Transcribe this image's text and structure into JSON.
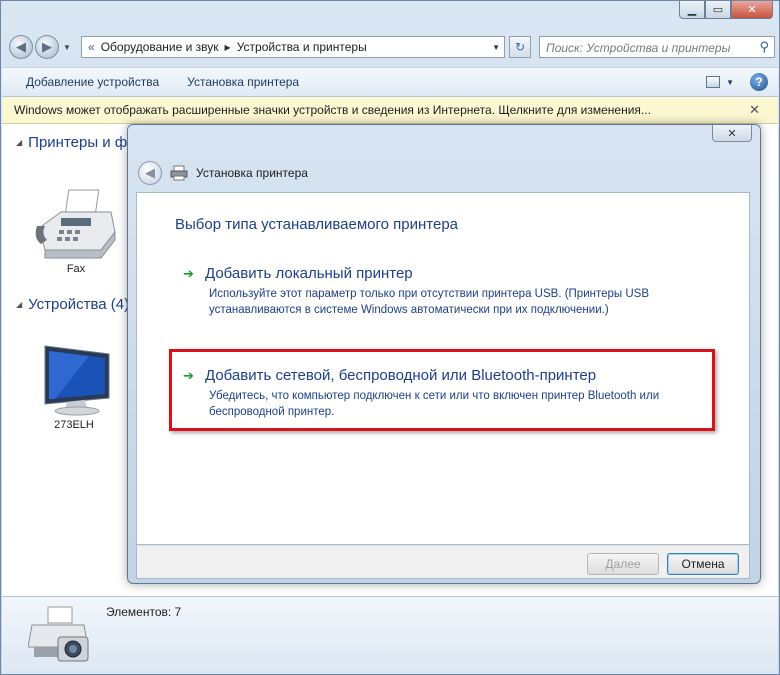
{
  "window": {
    "caption_buttons": {
      "minimize": "▁",
      "maximize": "▭",
      "close": "✕"
    }
  },
  "nav": {
    "back_icon": "◀",
    "forward_icon": "▶",
    "breadcrumb": [
      "Оборудование и звук",
      "Устройства и принтеры"
    ],
    "search_placeholder": "Поиск: Устройства и принтеры"
  },
  "toolbar": {
    "add_device": "Добавление устройства",
    "add_printer": "Установка принтера"
  },
  "infobar": {
    "text": "Windows может отображать расширенные значки устройств и сведения из Интернета.  Щелкните для изменения..."
  },
  "groups": {
    "printers": "Принтеры и ф",
    "devices": "Устройства (4)"
  },
  "devices": {
    "fax": "Fax",
    "monitor": "273ELH"
  },
  "status": {
    "items": "Элементов: 7"
  },
  "dialog": {
    "title": "Установка принтера",
    "heading": "Выбор типа устанавливаемого принтера",
    "options": [
      {
        "title": "Добавить локальный принтер",
        "desc": "Используйте этот параметр только при отсутствии принтера USB. (Принтеры USB устанавливаются в системе Windows автоматически при их подключении.)"
      },
      {
        "title": "Добавить сетевой, беспроводной или Bluetooth-принтер",
        "desc": "Убедитесь, что компьютер подключен к сети или что включен принтер Bluetooth или беспроводной принтер."
      }
    ],
    "next": "Далее",
    "cancel": "Отмена"
  },
  "colors": {
    "accent_blue": "#1d3f8a",
    "highlight_red": "#d6131a",
    "arrow_green": "#1d9a2b"
  }
}
